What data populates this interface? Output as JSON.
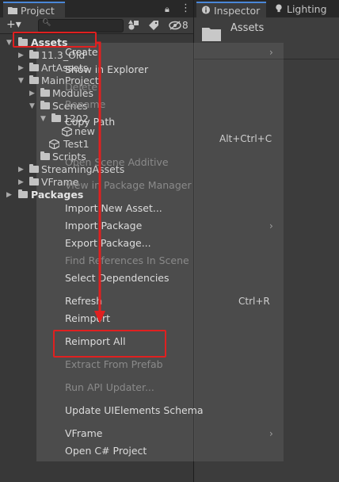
{
  "tabs": {
    "project": "Project",
    "inspector": "Inspector",
    "lighting": "Lighting"
  },
  "toolbar": {
    "add_label": "+▾",
    "hidden_count": "8"
  },
  "tree": [
    {
      "label": "Assets",
      "expanded": true
    },
    {
      "label": "11.3_Old",
      "expanded": false
    },
    {
      "label": "ArtAssets",
      "expanded": false
    },
    {
      "label": "MainProject",
      "expanded": true
    },
    {
      "label": "Modules",
      "expanded": false
    },
    {
      "label": "Scenes",
      "expanded": true
    },
    {
      "label": "1202",
      "expanded": true
    },
    {
      "label": "new",
      "kind": "scene"
    },
    {
      "label": "Test1",
      "kind": "scene"
    },
    {
      "label": "Scripts",
      "kind": "folder"
    },
    {
      "label": "StreamingAssets",
      "expanded": false
    },
    {
      "label": "VFrame",
      "expanded": false
    },
    {
      "label": "Packages",
      "expanded": false
    }
  ],
  "inspector": {
    "title": "Assets"
  },
  "menu": {
    "items": [
      {
        "label": "Create",
        "enabled": true,
        "submenu": true
      },
      {
        "label": "Show in Explorer",
        "enabled": true
      },
      {
        "label": "Delete",
        "enabled": false
      },
      {
        "label": "Rename",
        "enabled": false
      },
      {
        "label": "Copy Path",
        "enabled": true,
        "shortcut": "Alt+Ctrl+C"
      },
      {
        "label": "Open Scene Additive",
        "enabled": false
      },
      {
        "label": "View in Package Manager",
        "enabled": false
      },
      {
        "label": "Import New Asset...",
        "enabled": true
      },
      {
        "label": "Import Package",
        "enabled": true,
        "submenu": true
      },
      {
        "label": "Export Package...",
        "enabled": true
      },
      {
        "label": "Find References In Scene",
        "enabled": false
      },
      {
        "label": "Select Dependencies",
        "enabled": true
      },
      {
        "label": "Refresh",
        "enabled": true,
        "shortcut": "Ctrl+R"
      },
      {
        "label": "Reimport",
        "enabled": true
      },
      {
        "label": "Reimport All",
        "enabled": true
      },
      {
        "label": "Extract From Prefab",
        "enabled": false
      },
      {
        "label": "Run API Updater...",
        "enabled": false
      },
      {
        "label": "Update UIElements Schema",
        "enabled": true
      },
      {
        "label": "VFrame",
        "enabled": true,
        "submenu": true
      },
      {
        "label": "Open C# Project",
        "enabled": true
      }
    ]
  },
  "colors": {
    "annotation": "#e02020",
    "accent": "#4a87d8"
  }
}
